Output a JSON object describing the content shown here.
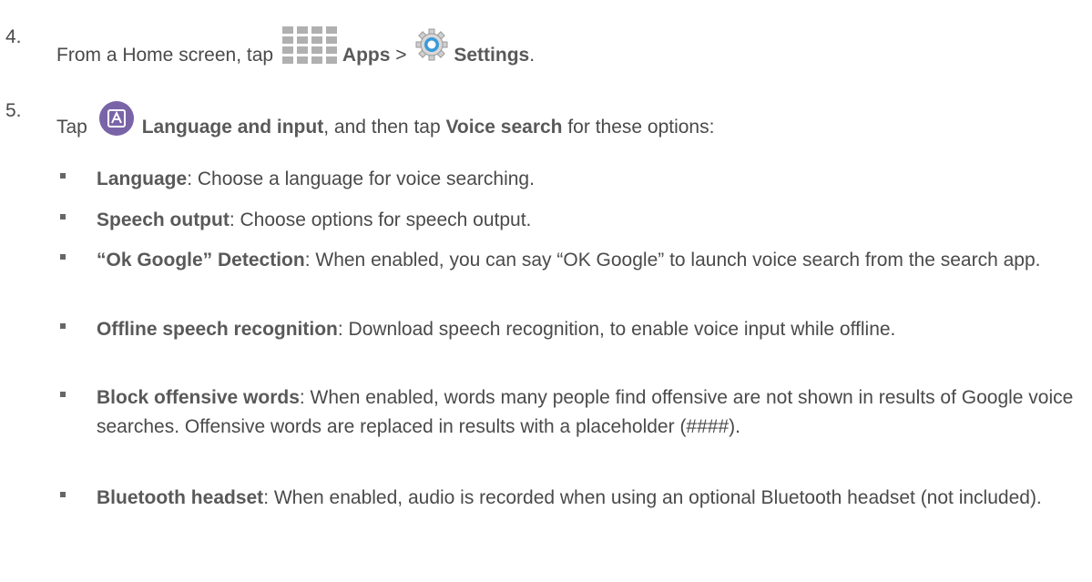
{
  "step4": {
    "number": "4.",
    "prefix": "From a Home screen, tap ",
    "apps_label": "Apps",
    "separator": " > ",
    "settings_label": "Settings",
    "suffix": ".",
    "apps_icon": "apps-grid-icon",
    "settings_icon": "gear-icon"
  },
  "step5": {
    "number": "5.",
    "prefix": "Tap ",
    "language_label": "Language and input",
    "middle": ", and then tap ",
    "voice_label": "Voice search",
    "suffix": " for these options:",
    "language_icon": "language-a-icon"
  },
  "options": [
    {
      "term": "Language",
      "text": ": Choose a language for voice searching."
    },
    {
      "term": "Speech output",
      "text": ": Choose options for speech output."
    },
    {
      "term": "“Ok Google” Detection",
      "text": ": When enabled, you can say “OK Google” to launch voice search from the search app."
    },
    {
      "term": "Offline speech recognition",
      "text": ": Download speech recognition, to enable voice input while offline."
    },
    {
      "term": "Block offensive words",
      "text": ": When enabled, words many people find offensive are not shown in results of Google voice searches. Offensive words are replaced in results with a placeholder (####)."
    },
    {
      "term": "Bluetooth headset",
      "text": ": When enabled, audio is recorded when using an optional Bluetooth headset (not included)."
    }
  ],
  "colors": {
    "text": "#4a4a4a",
    "bullet": "#666666",
    "apps_icon": "#b0b0b0",
    "settings_accent": "#3a9ad9",
    "language_icon": "#7a64a8"
  }
}
